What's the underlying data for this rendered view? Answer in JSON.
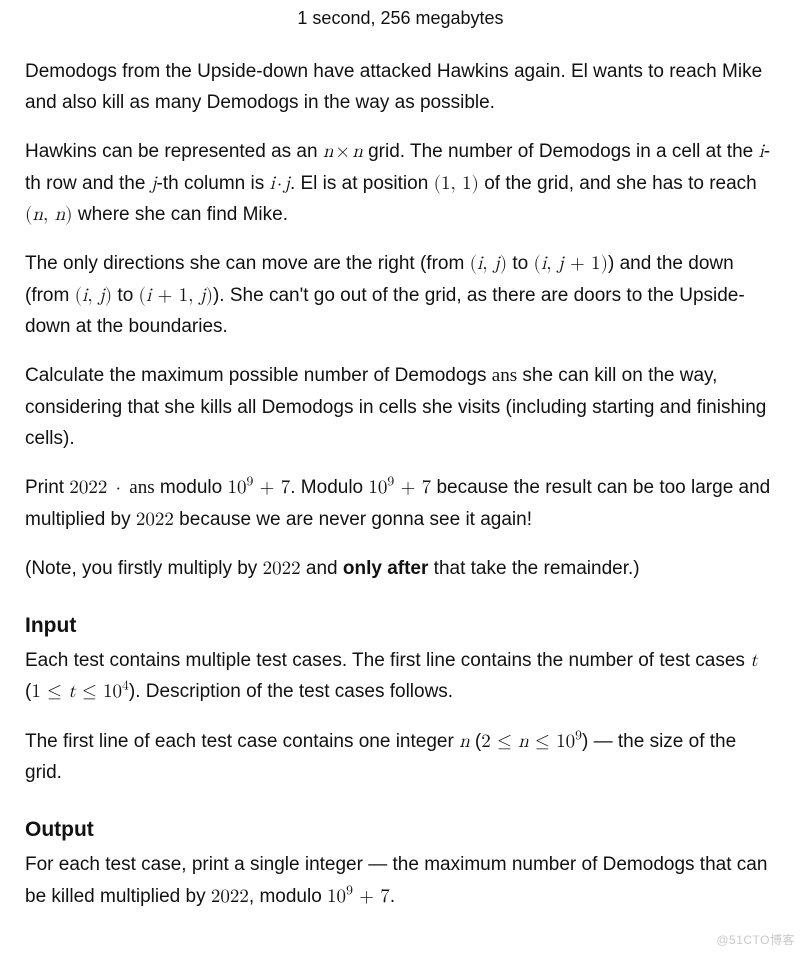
{
  "limits": "1 second, 256 megabytes",
  "p1": {
    "t0": "Demodogs from the Upside-down have attacked Hawkins again. El wants to reach Mike and also kill as many Demodogs in the way as possible."
  },
  "p2": {
    "t0": "Hawkins can be represented as an ",
    "m_nxn_a": "n",
    "m_nxn_x": "×",
    "m_nxn_b": "n",
    "t1": " grid. The number of Demodogs in a cell at the ",
    "m_i": "i",
    "t2": "-th row and the ",
    "m_j": "j",
    "t3": "-th column is ",
    "m_ij_a": "i",
    "m_ij_dot": "·",
    "m_ij_b": "j",
    "t4": ". El is at position ",
    "m_11": "(1, 1)",
    "t5": " of the grid, and she has to reach ",
    "m_nn_l": "(",
    "m_nn_a": "n",
    "m_nn_c": ", ",
    "m_nn_b": "n",
    "m_nn_r": ")",
    "t6": " where she can find Mike."
  },
  "p3": {
    "t0": "The only directions she can move are the right (from ",
    "m_ij_l": "(",
    "m_ij_i": "i",
    "m_ij_c": ", ",
    "m_ij_j": "j",
    "m_ij_r": ")",
    "t1": " to ",
    "m_ij1_l": "(",
    "m_ij1_i": "i",
    "m_ij1_c": ", ",
    "m_ij1_j": "j",
    "m_ij1_p": " + 1",
    "m_ij1_r": ")",
    "t2": ") and the down (from ",
    "m_ij2_l": "(",
    "m_ij2_i": "i",
    "m_ij2_c": ", ",
    "m_ij2_j": "j",
    "m_ij2_r": ")",
    "t3": " to ",
    "m_i1j_l": "(",
    "m_i1j_i": "i",
    "m_i1j_p": " + 1",
    "m_i1j_c": ", ",
    "m_i1j_j": "j",
    "m_i1j_r": ")",
    "t4": "). She can't go out of the grid, as there are doors to the Upside-down at the boundaries."
  },
  "p4": {
    "t0": "Calculate the maximum possible number of Demodogs ",
    "m_ans": "ans",
    "t1": " she can kill on the way, considering that she kills all Demodogs in cells she visits (including starting and finishing cells)."
  },
  "p5": {
    "t0": "Print ",
    "m_2022a": "2022",
    "m_dot1": " · ",
    "m_ans2": "ans",
    "t1": " modulo ",
    "m_1e9a_b": "10",
    "m_1e9a_e": "9",
    "m_1e9a_p": " + 7",
    "t2": ". Modulo ",
    "m_1e9b_b": "10",
    "m_1e9b_e": "9",
    "m_1e9b_p": " + 7",
    "t3": " because the result can be too large and multiplied by ",
    "m_2022b": "2022",
    "t4": " because we are never gonna see it again!"
  },
  "p6": {
    "t0": "(Note, you firstly multiply by ",
    "m_2022": "2022",
    "t1": " and ",
    "b": "only after",
    "t2": " that take the remainder.)"
  },
  "input": {
    "h": "Input",
    "p1": {
      "t0": "Each test contains multiple test cases. The first line contains the number of test cases ",
      "m_t": "t",
      "t1": " (",
      "m_r_l": "1 ≤ ",
      "m_r_t": "t",
      "m_r_r": " ≤ 10",
      "m_r_e": "4",
      "t2": "). Description of the test cases follows."
    },
    "p2": {
      "t0": "The first line of each test case contains one integer ",
      "m_n": "n",
      "t1": " (",
      "m_r_l": "2 ≤ ",
      "m_r_n": "n",
      "m_r_r": " ≤ 10",
      "m_r_e": "9",
      "t2": ") — the size of the grid."
    }
  },
  "output": {
    "h": "Output",
    "p1": {
      "t0": "For each test case, print a single integer — the maximum number of Demodogs that can be killed multiplied by ",
      "m_2022": "2022",
      "t1": ", modulo ",
      "m_1e9_b": "10",
      "m_1e9_e": "9",
      "m_1e9_p": " + 7",
      "t2": "."
    }
  },
  "watermark": "@51CTO博客"
}
